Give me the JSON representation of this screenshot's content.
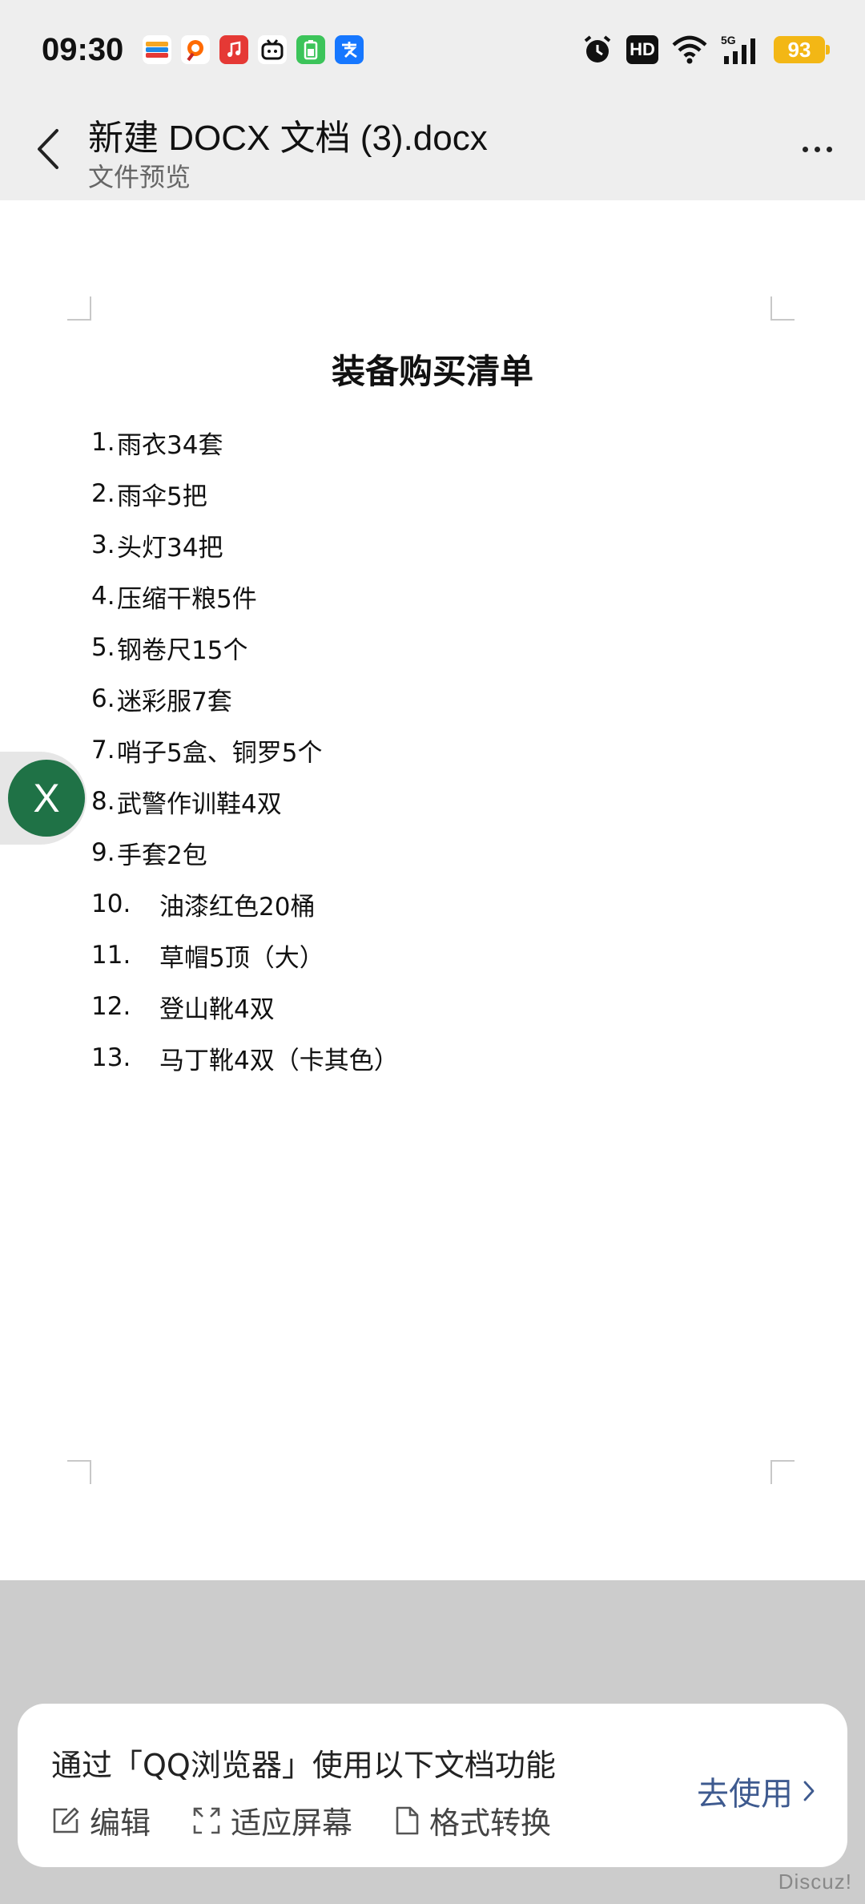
{
  "status_bar": {
    "time": "09:30",
    "notification_icons": [
      {
        "name": "wallet-app-icon",
        "color": "#ffffff",
        "glyph": "▬"
      },
      {
        "name": "taobao-app-icon",
        "color": "#ffffff",
        "glyph": "☺"
      },
      {
        "name": "music-app-icon",
        "color": "#e53935",
        "glyph": "♪"
      },
      {
        "name": "bilibili-app-icon",
        "color": "#ffffff",
        "glyph": "📺"
      },
      {
        "name": "battery-app-icon",
        "color": "#3cc45a",
        "glyph": "▮"
      },
      {
        "name": "alipay-app-icon",
        "color": "#1677ff",
        "glyph": "支"
      }
    ],
    "hd_label": "HD",
    "network_label": "5G",
    "battery_level": "93",
    "battery_color": "#f3b715"
  },
  "header": {
    "title": "新建 DOCX 文档 (3).docx",
    "subtitle": "文件预览"
  },
  "document": {
    "heading": "装备购买清单",
    "items": [
      {
        "num": "1.",
        "text": "雨衣34套"
      },
      {
        "num": "2.",
        "text": "雨伞5把"
      },
      {
        "num": "3.",
        "text": "头灯34把"
      },
      {
        "num": "4.",
        "text": "压缩干粮5件"
      },
      {
        "num": "5.",
        "text": "钢卷尺15个"
      },
      {
        "num": "6.",
        "text": "迷彩服7套"
      },
      {
        "num": "7.",
        "text": "哨子5盒、铜罗5个"
      },
      {
        "num": "8.",
        "text": "武警作训鞋4双"
      },
      {
        "num": "9.",
        "text": "手套2包"
      },
      {
        "num": "10.",
        "text": "油漆红色20桶"
      },
      {
        "num": "11.",
        "text": "草帽5顶（大）"
      },
      {
        "num": "12.",
        "text": "登山靴4双"
      },
      {
        "num": "13.",
        "text": "马丁靴4双（卡其色）"
      }
    ]
  },
  "floating_button": {
    "label": "X",
    "color": "#1f7246"
  },
  "promo": {
    "title": "通过「QQ浏览器」使用以下文档功能",
    "features": [
      {
        "icon": "edit-icon",
        "label": "编辑"
      },
      {
        "icon": "fit-screen-icon",
        "label": "适应屏幕"
      },
      {
        "icon": "file-convert-icon",
        "label": "格式转换"
      }
    ],
    "cta_label": "去使用",
    "cta_color": "#3e5a8f"
  },
  "watermark": "Discuz!"
}
